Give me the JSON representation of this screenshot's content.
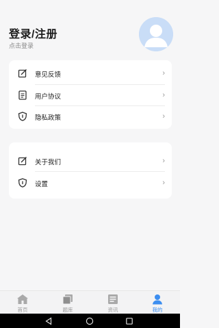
{
  "header": {
    "title": "登录/注册",
    "subtitle": "点击登录"
  },
  "menu_group_1": [
    {
      "label": "意见反馈",
      "icon": "edit-icon"
    },
    {
      "label": "用户协议",
      "icon": "document-icon"
    },
    {
      "label": "隐私政策",
      "icon": "shield-icon"
    }
  ],
  "menu_group_2": [
    {
      "label": "关于我们",
      "icon": "edit-icon"
    },
    {
      "label": "设置",
      "icon": "shield-icon"
    }
  ],
  "chevron": "›",
  "tabs": [
    {
      "label": "首页",
      "icon": "home-icon",
      "active": false
    },
    {
      "label": "题库",
      "icon": "question-bank-icon",
      "active": false
    },
    {
      "label": "资讯",
      "icon": "news-icon",
      "active": false
    },
    {
      "label": "我的",
      "icon": "profile-icon",
      "active": true
    }
  ],
  "colors": {
    "accent": "#3c8ef0",
    "background": "#f6f6f7",
    "card": "#ffffff",
    "avatar_bg": "#c9ddf7"
  }
}
